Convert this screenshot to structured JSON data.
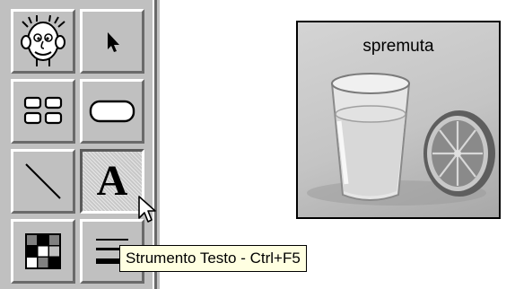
{
  "palette": {
    "tools": [
      {
        "name": "character-tool",
        "icon": "cartoon-face-icon"
      },
      {
        "name": "select-tool",
        "icon": "arrow-pointer-icon"
      },
      {
        "name": "group-tool",
        "icon": "grouped-boxes-icon"
      },
      {
        "name": "rounded-rect-tool",
        "icon": "rounded-rectangle-icon"
      },
      {
        "name": "line-tool",
        "icon": "diagonal-line-icon"
      },
      {
        "name": "text-tool",
        "icon": "letter-a-icon",
        "label": "A",
        "pressed": true
      },
      {
        "name": "color-tool",
        "icon": "color-grid-icon"
      },
      {
        "name": "line-style-tool",
        "icon": "line-thickness-icon"
      }
    ]
  },
  "canvas": {
    "image": {
      "caption": "spremuta",
      "subject": "glass of orange juice and half orange"
    }
  },
  "tooltip": {
    "text": "Strumento Testo - Ctrl+F5"
  },
  "cursor": {
    "icon": "mouse-pointer-icon"
  }
}
